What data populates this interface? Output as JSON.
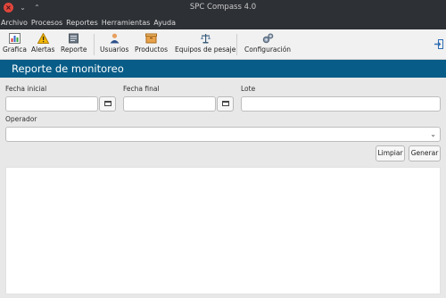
{
  "window": {
    "title": "SPC Compass 4.0"
  },
  "menu": [
    "Archivo",
    "Procesos",
    "Reportes",
    "Herramientas",
    "Ayuda"
  ],
  "toolbar": {
    "items": [
      {
        "label": "Grafica",
        "icon": "bar-chart-icon"
      },
      {
        "label": "Alertas",
        "icon": "warning-icon"
      },
      {
        "label": "Reporte",
        "icon": "report-icon"
      },
      {
        "label": "Usuarios",
        "icon": "users-icon"
      },
      {
        "label": "Productos",
        "icon": "box-icon"
      },
      {
        "label": "Equipos de pesaje",
        "icon": "scale-icon"
      },
      {
        "label": "Configuración",
        "icon": "gears-icon"
      }
    ]
  },
  "page": {
    "title": "Reporte de monitoreo"
  },
  "form": {
    "fecha_inicial_label": "Fecha inicial",
    "fecha_inicial_value": "",
    "fecha_final_label": "Fecha final",
    "fecha_final_value": "",
    "lote_label": "Lote",
    "lote_value": "",
    "operador_label": "Operador",
    "operador_value": ""
  },
  "actions": {
    "limpiar": "Limpiar",
    "generar": "Generar"
  },
  "colors": {
    "header_bg": "#085d88",
    "titlebar_bg": "#2d3035",
    "close": "#e0463c"
  }
}
